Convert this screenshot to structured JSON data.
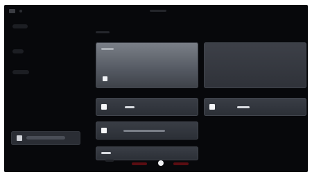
{
  "topbar": {
    "title": "",
    "logo": "app-logo"
  },
  "sidebar": {
    "active_item": ""
  },
  "content": {
    "section_title": "",
    "cards": [],
    "footer_label": ""
  },
  "bottom_nav": {
    "items": []
  },
  "colors": {
    "accent": "#8c1a22",
    "background": "#07080b",
    "card": "#3a3e46",
    "selected": "#2a2d34"
  }
}
